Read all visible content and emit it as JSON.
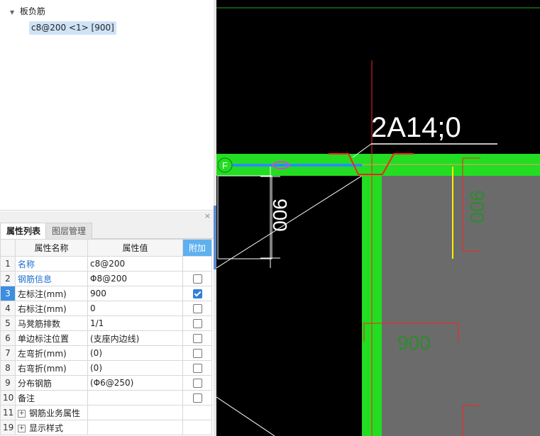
{
  "tree": {
    "root_label": "板负筋",
    "node_label": "c8@200 <1> [900]"
  },
  "panel": {
    "close_glyph": "×",
    "tabs": [
      {
        "label": "属性列表",
        "active": true
      },
      {
        "label": "图层管理",
        "active": false
      }
    ],
    "columns": {
      "name": "属性名称",
      "value": "属性值",
      "extra": "附加"
    },
    "rows": [
      {
        "num": "1",
        "name": "名称",
        "value": "c8@200",
        "checkbox": "none",
        "blue": true
      },
      {
        "num": "2",
        "name": "钢筋信息",
        "value": "Φ8@200",
        "checkbox": "unchecked",
        "blue": true
      },
      {
        "num": "3",
        "name": "左标注(mm)",
        "value": "900",
        "checkbox": "checked",
        "blue": false,
        "selected": true
      },
      {
        "num": "4",
        "name": "右标注(mm)",
        "value": "0",
        "checkbox": "unchecked",
        "blue": false
      },
      {
        "num": "5",
        "name": "马凳筋排数",
        "value": "1/1",
        "checkbox": "unchecked",
        "blue": false
      },
      {
        "num": "6",
        "name": "单边标注位置",
        "value": "(支座内边线)",
        "checkbox": "unchecked",
        "blue": false
      },
      {
        "num": "7",
        "name": "左弯折(mm)",
        "value": "(0)",
        "checkbox": "unchecked",
        "blue": false
      },
      {
        "num": "8",
        "name": "右弯折(mm)",
        "value": "(0)",
        "checkbox": "unchecked",
        "blue": false
      },
      {
        "num": "9",
        "name": "分布钢筋",
        "value": "(Φ6@250)",
        "checkbox": "unchecked",
        "blue": false
      },
      {
        "num": "10",
        "name": "备注",
        "value": "",
        "checkbox": "unchecked",
        "blue": false
      },
      {
        "num": "11",
        "name": "钢筋业务属性",
        "value": "",
        "checkbox": "none",
        "blue": false,
        "expandable": true
      },
      {
        "num": "19",
        "name": "显示样式",
        "value": "",
        "checkbox": "none",
        "blue": false,
        "expandable": true
      }
    ]
  },
  "canvas": {
    "rebar_label": "2A14;0",
    "axis_label": "F",
    "dim_left": "900",
    "dim_bottom": "900",
    "dim_right": "900",
    "colors": {
      "background": "#000000",
      "beam_green": "#22dd22",
      "slab_gray": "#6b6b6b",
      "rebar_red": "#ff2020",
      "dim_white": "#ffffff",
      "dim_green": "#2e8b2e",
      "rebar_blue": "#2b8cff",
      "yellow": "#ffee00"
    }
  }
}
